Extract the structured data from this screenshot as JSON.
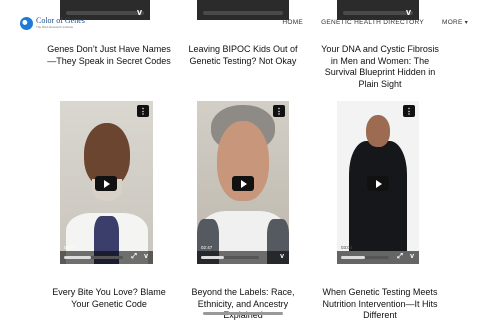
{
  "header": {
    "logo_text": "Color of Genes",
    "logo_sub": "The DNA Research Institute",
    "nav": [
      {
        "label": "HOME"
      },
      {
        "label": "GENETIC HEALTH DIRECTORY"
      },
      {
        "label": "MORE"
      }
    ]
  },
  "top_row_titles": [
    "Genes Don’t Just Have Names\n—They Speak in Secret Codes",
    "Leaving BIPOC Kids Out of\nGenetic Testing? Not Okay",
    "Your DNA and Cystic Fibrosis\nin Men and Women: The\nSurvival Blueprint Hidden in\nPlain Sight"
  ],
  "videos": [
    {
      "time": "02:47",
      "progress": 0.45,
      "title": "Every Bite You Love? Blame\nYour Genetic Code"
    },
    {
      "time": "02:47",
      "progress": 0.4,
      "title": "Beyond the Labels: Race,\nEthnicity, and Ancestry\nExplained"
    },
    {
      "time": "03:03",
      "progress": 0.5,
      "title": "When Genetic Testing Meets\nNutrition Intervention—It Hits\nDifferent"
    }
  ],
  "icons": {
    "menu": "⋮",
    "vimeo": "v",
    "fullscreen": "⤢",
    "caret": "▾"
  },
  "colors": {
    "logo_blue": "#1e7ad9",
    "video_bg_1": "#d9d6cf",
    "video_bg_2": "#cfcac0",
    "video_bg_3": "#f2f2f2"
  }
}
